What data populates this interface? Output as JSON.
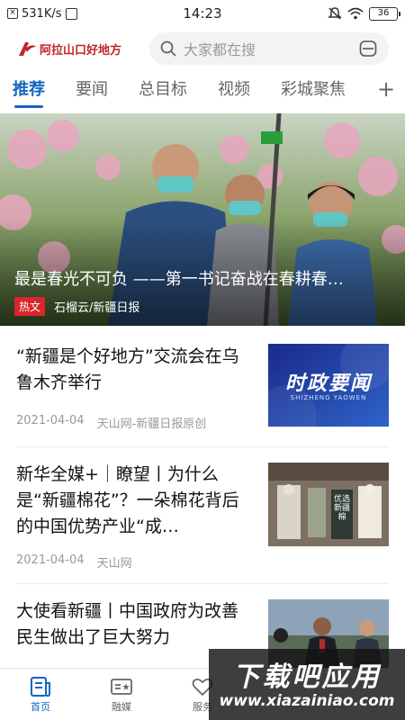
{
  "status_bar": {
    "network_speed": "531K/s",
    "time": "14:23",
    "battery": "36"
  },
  "header": {
    "logo_text": "阿拉山口好地方",
    "search_placeholder": "大家都在搜"
  },
  "tabs": [
    {
      "label": "推荐",
      "active": true
    },
    {
      "label": "要闻",
      "active": false
    },
    {
      "label": "总目标",
      "active": false
    },
    {
      "label": "视频",
      "active": false
    },
    {
      "label": "彩城聚焦",
      "active": false
    }
  ],
  "hero": {
    "title": "最是春光不可负 ——第一书记奋战在春耕春…",
    "tag": "热文",
    "source": "石榴云/新疆日报"
  },
  "articles": [
    {
      "title": "“新疆是个好地方”交流会在乌鲁木齐举行",
      "date": "2021-04-04",
      "source": "天山网-新疆日报原创",
      "thumb_text": "时政要闻",
      "thumb_subtext": "SHIZHENG YAOWEN"
    },
    {
      "title": "新华全媒+｜瞭望丨为什么是“新疆棉花”？一朵棉花背后的中国优势产业“成…",
      "date": "2021-04-04",
      "source": "天山网",
      "thumb_text": "优选新疆棉"
    },
    {
      "title": "大使看新疆丨中国政府为改善民生做出了巨大努力"
    }
  ],
  "bottom_nav": [
    {
      "label": "首页",
      "active": true
    },
    {
      "label": "融媒",
      "active": false
    },
    {
      "label": "服务",
      "active": false
    }
  ],
  "watermark": {
    "title": "下载吧应用",
    "url": "www.xiazainiao.com"
  },
  "colors": {
    "accent": "#1565c0",
    "brand_red": "#c0262d",
    "hot_tag": "#d8262c"
  }
}
